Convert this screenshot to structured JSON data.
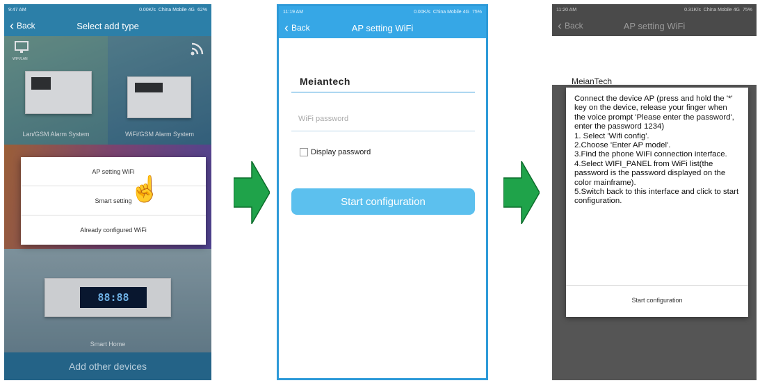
{
  "phone1": {
    "status": {
      "time": "9:47 AM",
      "speed": "0.00K/s",
      "carrier": "China Mobile 4G",
      "battery": "62%"
    },
    "back_label": "Back",
    "title": "Select add type",
    "tiles": [
      {
        "label": "Lan/GSM Alarm System"
      },
      {
        "label": "WiFi/GSM Alarm System"
      },
      {
        "label": ""
      },
      {
        "label": "Smart Home"
      }
    ],
    "wifi_lan_badge": "WIFI/LAN",
    "led_display": "88:88",
    "add_other": "Add other devices",
    "dialog": [
      "AP setting WiFi",
      "Smart setting",
      "Already configured WiFi"
    ]
  },
  "phone2": {
    "status": {
      "time": "11:19 AM",
      "speed": "0.00K/s",
      "carrier": "China Mobile 4G",
      "battery": "75%"
    },
    "back_label": "Back",
    "title": "AP setting WiFi",
    "ssid_value": "Meiantech",
    "password_placeholder": "WiFi password",
    "display_password": "Display password",
    "start_button": "Start configuration"
  },
  "phone3": {
    "status": {
      "time": "11:20 AM",
      "speed": "0.31K/s",
      "carrier": "China Mobile 4G",
      "battery": "75%"
    },
    "back_label": "Back",
    "title": "AP setting WiFi",
    "ssid_value": "MeianTech",
    "instructions": [
      "Connect the device AP (press and hold the '*' key on the device, release your finger when the voice prompt 'Please enter the password', enter the password 1234)",
      "1. Select 'Wifi config'.",
      "2.Choose 'Enter AP model'.",
      "3.Find the phone WiFi connection interface.",
      "4.Select WIFI_PANEL from WiFi list(the password is the password displayed on the color mainframe).",
      "5.Switch back to this interface and click to start configuration."
    ],
    "start_label": "Start configuration"
  },
  "colors": {
    "accent": "#36a7e6",
    "button": "#5cc0ee",
    "arrow": "#1fa34a"
  }
}
